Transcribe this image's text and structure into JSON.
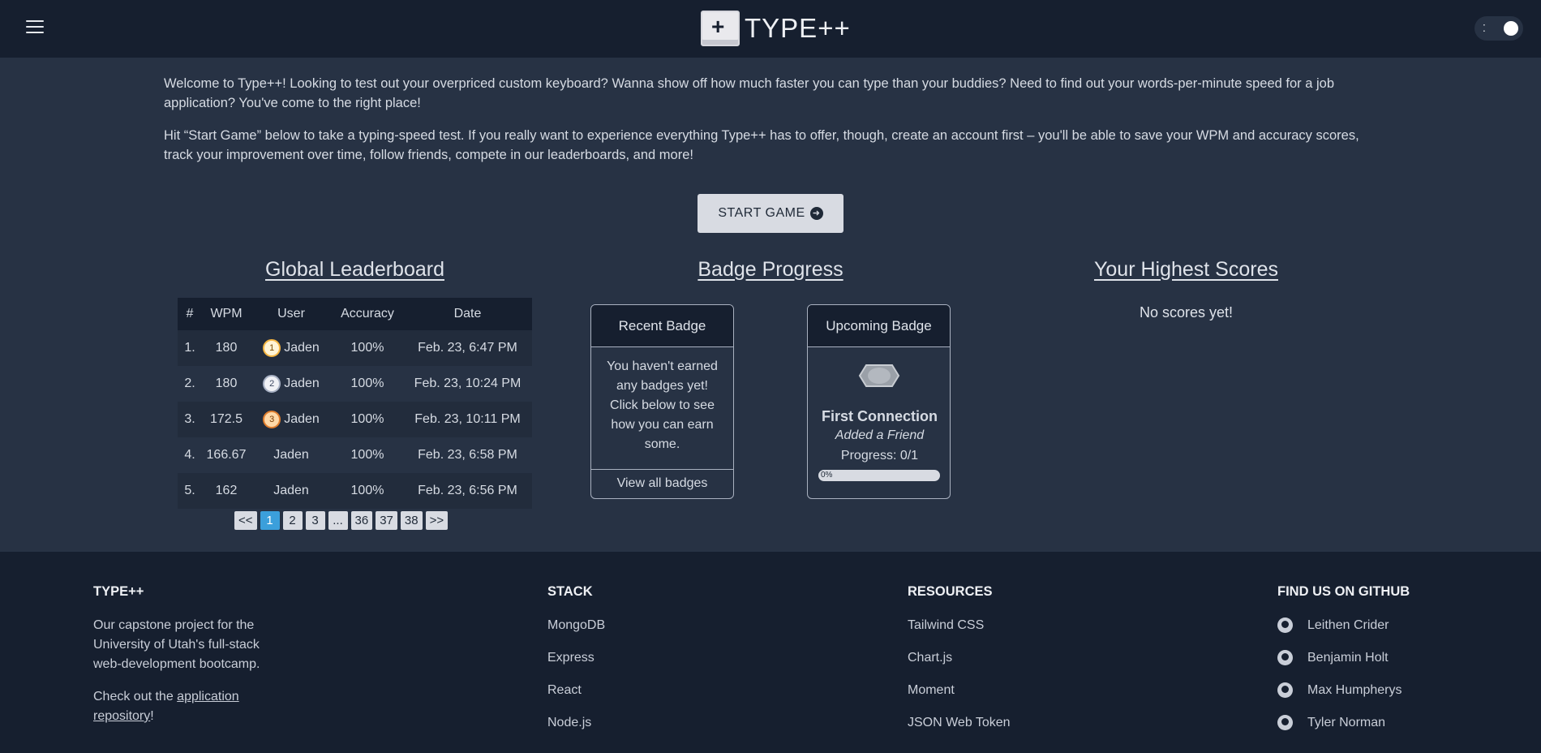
{
  "header": {
    "logo_text": "TYPE++",
    "logo_icon": "plus-keycap-icon",
    "menu_icon": "hamburger-menu-icon",
    "theme_toggle_icon": "theme-toggle-icon"
  },
  "intro": {
    "paragraph1": "Welcome to Type++! Looking to test out your overpriced custom keyboard? Wanna show off how much faster you can type than your buddies? Need to find out your words-per-minute speed for a job application? You've come to the right place!",
    "paragraph2": "Hit “Start Game” below to take a typing-speed test. If you really want to experience everything Type++ has to offer, though, create an account first – you'll be able to save your WPM and accuracy scores, track your improvement over time, follow friends, compete in our leaderboards, and more!"
  },
  "start_button": {
    "label": "START GAME",
    "icon": "arrow-right-circle-icon"
  },
  "leaderboard": {
    "title": "Global Leaderboard",
    "columns": [
      "#",
      "WPM",
      "User",
      "Accuracy",
      "Date"
    ],
    "rows": [
      {
        "rank": "1.",
        "wpm": "180",
        "user": "Jaden",
        "medal": "1",
        "accuracy": "100%",
        "date": "Feb. 23, 6:47 PM"
      },
      {
        "rank": "2.",
        "wpm": "180",
        "user": "Jaden",
        "medal": "2",
        "accuracy": "100%",
        "date": "Feb. 23, 10:24 PM"
      },
      {
        "rank": "3.",
        "wpm": "172.5",
        "user": "Jaden",
        "medal": "3",
        "accuracy": "100%",
        "date": "Feb. 23, 10:11 PM"
      },
      {
        "rank": "4.",
        "wpm": "166.67",
        "user": "Jaden",
        "medal": "",
        "accuracy": "100%",
        "date": "Feb. 23, 6:58 PM"
      },
      {
        "rank": "5.",
        "wpm": "162",
        "user": "Jaden",
        "medal": "",
        "accuracy": "100%",
        "date": "Feb. 23, 6:56 PM"
      }
    ],
    "pagination": [
      "<<",
      "1",
      "2",
      "3",
      "...",
      "36",
      "37",
      "38",
      ">>"
    ],
    "current_page": "1"
  },
  "badges": {
    "title": "Badge Progress",
    "recent": {
      "header": "Recent Badge",
      "body": "You haven't earned any badges yet! Click below to see how you can earn some.",
      "footer": "View all badges"
    },
    "upcoming": {
      "header": "Upcoming Badge",
      "name": "First Connection",
      "description": "Added a Friend",
      "progress_text": "Progress: 0/1",
      "progress_label": "0%",
      "progress_value": 0,
      "icon": "badge-shield-icon"
    }
  },
  "highest_scores": {
    "title": "Your Highest Scores",
    "empty_text": "No scores yet!"
  },
  "footer": {
    "about": {
      "title": "TYPE++",
      "description": "Our capstone project for the University of Utah's full-stack web-development bootcamp.",
      "cta_prefix": "Check out the ",
      "cta_link": "application repository",
      "cta_suffix": "!"
    },
    "stack": {
      "title": "STACK",
      "items": [
        "MongoDB",
        "Express",
        "React",
        "Node.js"
      ]
    },
    "resources": {
      "title": "RESOURCES",
      "items": [
        "Tailwind CSS",
        "Chart.js",
        "Moment",
        "JSON Web Token"
      ]
    },
    "github": {
      "title": "FIND US ON GITHUB",
      "icon": "github-icon",
      "items": [
        "Leithen Crider",
        "Benjamin Holt",
        "Max Humpherys",
        "Tyler Norman"
      ]
    }
  },
  "colors": {
    "page_bg": "#273244",
    "header_bg": "#161f2f",
    "accent": "#3b9fdb",
    "button_bg": "#d8dbe2"
  }
}
